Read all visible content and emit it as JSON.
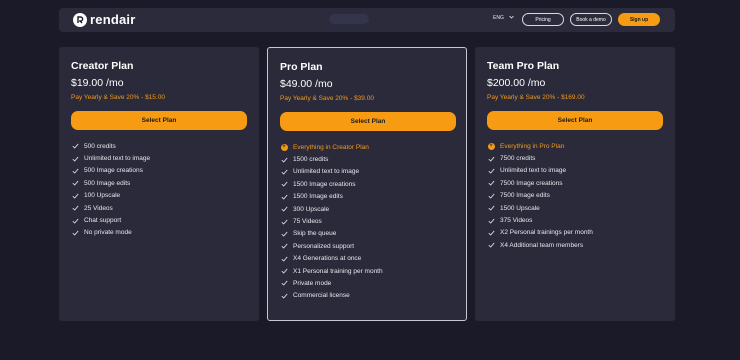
{
  "nav": {
    "brand": "rendair",
    "language": "ENG",
    "pricing_label": "Pricing",
    "demo_label": "Book a demo",
    "signup_label": "Sign up"
  },
  "plans": [
    {
      "name": "Creator Plan",
      "price": "$19.00 /mo",
      "save": "Pay Yearly & Save 20% - $15.00",
      "button": "Select Plan",
      "features": [
        {
          "text": "500 credits",
          "icon": "check-icon"
        },
        {
          "text": "Unlimited text to image",
          "icon": "check-icon"
        },
        {
          "text": "500 Image creations",
          "icon": "check-icon"
        },
        {
          "text": "500 Image edits",
          "icon": "check-icon"
        },
        {
          "text": "100 Upscale",
          "icon": "check-icon"
        },
        {
          "text": "25 Videos",
          "icon": "check-icon"
        },
        {
          "text": "Chat support",
          "icon": "check-icon"
        },
        {
          "text": "No private mode",
          "icon": "check-icon"
        }
      ]
    },
    {
      "name": "Pro Plan",
      "price": "$49.00 /mo",
      "save": "Pay Yearly & Save 20% - $39.00",
      "button": "Select Plan",
      "features": [
        {
          "text": "Everything in Creator Plan",
          "icon": "plus-circle-icon"
        },
        {
          "text": "1500 credits",
          "icon": "check-icon"
        },
        {
          "text": "Unlimited text to image",
          "icon": "check-icon"
        },
        {
          "text": "1500 Image creations",
          "icon": "check-icon"
        },
        {
          "text": "1500 Image edits",
          "icon": "check-icon"
        },
        {
          "text": "300 Upscale",
          "icon": "check-icon"
        },
        {
          "text": "75 Videos",
          "icon": "check-icon"
        },
        {
          "text": "Skip the queue",
          "icon": "check-icon"
        },
        {
          "text": "Personalized support",
          "icon": "check-icon"
        },
        {
          "text": "X4 Generations at once",
          "icon": "check-icon"
        },
        {
          "text": "X1 Personal training per month",
          "icon": "check-icon"
        },
        {
          "text": "Private mode",
          "icon": "check-icon"
        },
        {
          "text": "Commercial license",
          "icon": "check-icon"
        }
      ]
    },
    {
      "name": "Team Pro Plan",
      "price": "$200.00 /mo",
      "save": "Pay Yearly & Save 20% - $169.00",
      "button": "Select Plan",
      "features": [
        {
          "text": "Everything in Pro Plan",
          "icon": "plus-circle-icon"
        },
        {
          "text": "7500 credits",
          "icon": "check-icon"
        },
        {
          "text": "Unlimited text to image",
          "icon": "check-icon"
        },
        {
          "text": "7500 Image creations",
          "icon": "check-icon"
        },
        {
          "text": "7500 Image edits",
          "icon": "check-icon"
        },
        {
          "text": "1500 Upscale",
          "icon": "check-icon"
        },
        {
          "text": "375 Videos",
          "icon": "check-icon"
        },
        {
          "text": "X2 Personal trainings per month",
          "icon": "check-icon"
        },
        {
          "text": "X4 Additional team members",
          "icon": "check-icon"
        }
      ]
    }
  ],
  "colors": {
    "accent": "#f79b12",
    "background": "#1a1a28",
    "card": "#2a2a3a"
  }
}
